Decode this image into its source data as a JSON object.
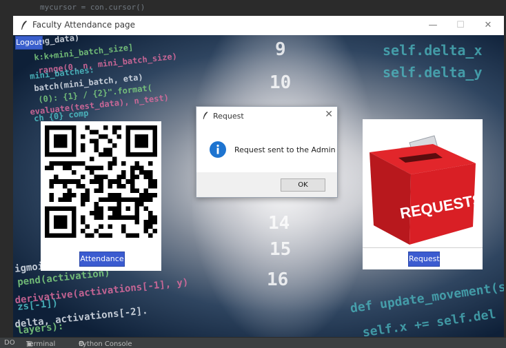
{
  "ide": {
    "top_code": "mycursor = con.cursor()",
    "bottom_left": "DO",
    "terminal": "Terminal",
    "python_console": "Python Console"
  },
  "window": {
    "title": "Faculty Attendance page",
    "minimize": "—",
    "maximize": "☐",
    "close": "✕"
  },
  "background": {
    "code_left": [
      "ning_data)",
      "k:k+mini_batch_size]",
      "range(0, n, mini_batch_size)",
      "mini_batches:",
      "batch(mini_batch, eta)",
      "(0): {1} / {2}\".format(",
      "evaluate(test_data), n_test)",
      "ch {0} comp",
      "igmoid(z)",
      "pend(activation)",
      "derivative(activations[-1], y)",
      "zs[-1])",
      "delta, activations[-2].",
      "layers):"
    ],
    "code_right": [
      "self.delta_x",
      "self.delta_y",
      "def update_movement(se",
      "self.x += self.del"
    ],
    "digits": [
      "9",
      "10",
      "14",
      "15",
      "16"
    ],
    "colors": {
      "code_green": "#7fd17f",
      "code_teal": "#4fc3c9",
      "code_pink": "#e06c9f",
      "code_white": "#e0e6ee"
    }
  },
  "logout_label": "Logout",
  "attendance_label": "Attendance",
  "request_label": "Request",
  "request_image_text": "REQUESTS",
  "dialog": {
    "title": "Request",
    "message": "Request sent to the Admin",
    "ok_label": "OK",
    "close": "✕"
  }
}
